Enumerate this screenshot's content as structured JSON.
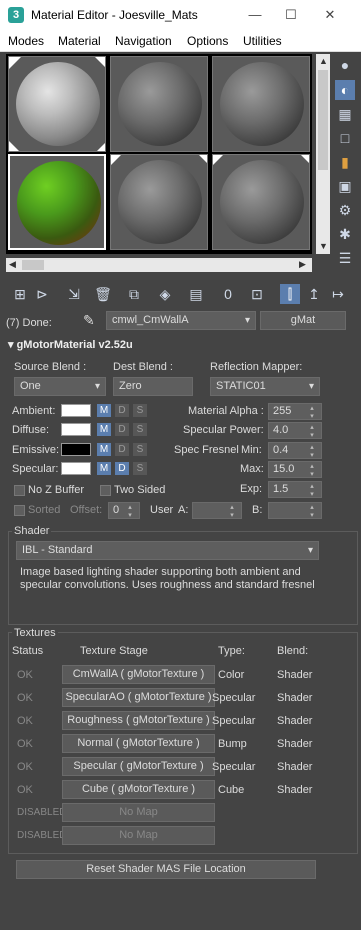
{
  "window": {
    "title": "Material Editor - Joesville_Mats",
    "app_icon": "3"
  },
  "menu": [
    "Modes",
    "Material",
    "Navigation",
    "Options",
    "Utilities"
  ],
  "slots": {
    "colors": {
      "green_sphere": "#4a9a1c",
      "grey_sphere": "#6d6d6d"
    }
  },
  "status": {
    "done_label": "(7) Done:",
    "material_name": "cmwl_CmWallA",
    "material_type_button": "gMat"
  },
  "rollout": {
    "title": "gMotorMaterial v2.52u",
    "source_blend_label": "Source Blend :",
    "source_blend_value": "One",
    "dest_blend_label": "Dest Blend :",
    "dest_blend_value": "Zero",
    "reflection_mapper_label": "Reflection Mapper:",
    "reflection_mapper_value": "STATIC01",
    "colors": [
      {
        "label": "Ambient:",
        "swatch": "#ffffff"
      },
      {
        "label": "Diffuse:",
        "swatch": "#ffffff"
      },
      {
        "label": "Emissive:",
        "swatch": "#000000"
      },
      {
        "label": "Specular:",
        "swatch": "#ffffff"
      }
    ],
    "mds": {
      "m": "M",
      "d": "D",
      "s": "S"
    },
    "material_alpha_label": "Material Alpha :",
    "material_alpha_value": "255",
    "specular_power_label": "Specular Power:",
    "specular_power_value": "4.0",
    "spec_fresnel_label": "Spec Fresnel",
    "min_label": "Min:",
    "min_value": "0.4",
    "max_label": "Max:",
    "max_value": "15.0",
    "exp_label": "Exp:",
    "exp_value": "1.5",
    "no_z_buffer_label": "No Z Buffer",
    "two_sided_label": "Two Sided",
    "sorted_label": "Sorted",
    "offset_label": "Offset:",
    "offset_value": "0",
    "user_label": "User",
    "a_label": "A:",
    "b_label": "B:"
  },
  "shader": {
    "group_label": "Shader",
    "selected": "IBL - Standard",
    "description": "Image based lighting shader supporting both ambient and specular convolutions. Uses roughness and standard fresnel"
  },
  "textures": {
    "group_label": "Textures",
    "headers": {
      "status": "Status",
      "stage": "Texture Stage",
      "type": "Type:",
      "blend": "Blend:"
    },
    "rows": [
      {
        "status": "OK",
        "stage": "CmWallA ( gMotorTexture )",
        "type": "Color",
        "blend": "Shader"
      },
      {
        "status": "OK",
        "stage": "SpecularAO ( gMotorTexture )",
        "type": "Specular",
        "blend": "Shader"
      },
      {
        "status": "OK",
        "stage": "Roughness ( gMotorTexture )",
        "type": "Specular",
        "blend": "Shader"
      },
      {
        "status": "OK",
        "stage": "Normal ( gMotorTexture )",
        "type": "Bump",
        "blend": "Shader"
      },
      {
        "status": "OK",
        "stage": "Specular ( gMotorTexture )",
        "type": "Specular",
        "blend": "Shader"
      },
      {
        "status": "OK",
        "stage": "Cube ( gMotorTexture )",
        "type": "Cube",
        "blend": "Shader"
      },
      {
        "status": "DISABLED",
        "stage": "No Map",
        "type": "",
        "blend": ""
      },
      {
        "status": "DISABLED",
        "stage": "No Map",
        "type": "",
        "blend": ""
      }
    ]
  },
  "reset_button": "Reset Shader MAS File Location"
}
